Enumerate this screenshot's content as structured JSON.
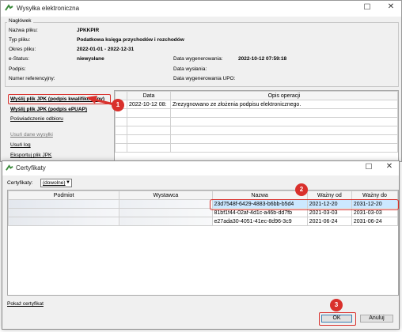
{
  "window1": {
    "title": "Wysyłka elektroniczna",
    "header": {
      "section_title": "Nagłówek",
      "nazwa_pliku_label": "Nazwa pliku:",
      "nazwa_pliku": "JPKKPIR",
      "typ_pliku_label": "Typ pliku:",
      "typ_pliku": "Podatkowa księga przychodów i rozchodów",
      "okres_label": "Okres pliku:",
      "okres": "2022-01-01 - 2022-12-31",
      "estatus_label": "e-Status:",
      "estatus": "niewysłane",
      "podpis_label": "Podpis:",
      "numer_ref_label": "Numer referencyjny:",
      "data_wygen_label": "Data wygenerowania:",
      "data_wygen": "2022-10-12 07:59:18",
      "data_wyslania_label": "Data wysłania:",
      "data_upo_label": "Data wygenerowania UPO:"
    },
    "links": {
      "wyslij_kwal": "Wyślij plik JPK (podpis kwalifikowany)",
      "wyslij_epuap": "Wyślij plik JPK (podpis ePUAP)",
      "poswiadczenie": "Poświadczenie odbioru",
      "usun_dane": "Usuń dane wysyłki",
      "usun_log": "Usuń log",
      "eksport": "Eksportuj plik JPK"
    },
    "log_table": {
      "columns": [
        "Data",
        "Opis operacji"
      ],
      "rows": [
        [
          "2022-10-12 08:",
          "Zrezygnowano ze złożenia podpisu elektronicznego."
        ]
      ]
    }
  },
  "window2": {
    "title": "Certyfikaty",
    "filter_label": "Certyfikaty:",
    "filter_value": "(dowolne)",
    "columns": [
      "Podmiot",
      "Wystawca",
      "Nazwa",
      "Ważny od",
      "Ważny do"
    ],
    "rows": [
      [
        "23d7548f-6429-4883-b6bb-b5d4",
        "2021-12-20",
        "2031-12-20"
      ],
      [
        "81bf1f44-02af-4d1c-a46b-dd7fb",
        "2021-03-03",
        "2031-03-03"
      ],
      [
        "e27ada30-4051-41ec-8d96-3c9",
        "2021-06-24",
        "2031-06-24"
      ]
    ],
    "show_cert_link": "Pokaż certyfikat",
    "ok_label": "OK",
    "cancel_label": "Anuluj"
  },
  "annotations": {
    "badge1": "1",
    "badge2": "2",
    "badge3": "3"
  },
  "colors": {
    "highlight_red": "#d9302c",
    "selection_blue": "#cce8ff",
    "link_blue": "#0b3ea8"
  }
}
